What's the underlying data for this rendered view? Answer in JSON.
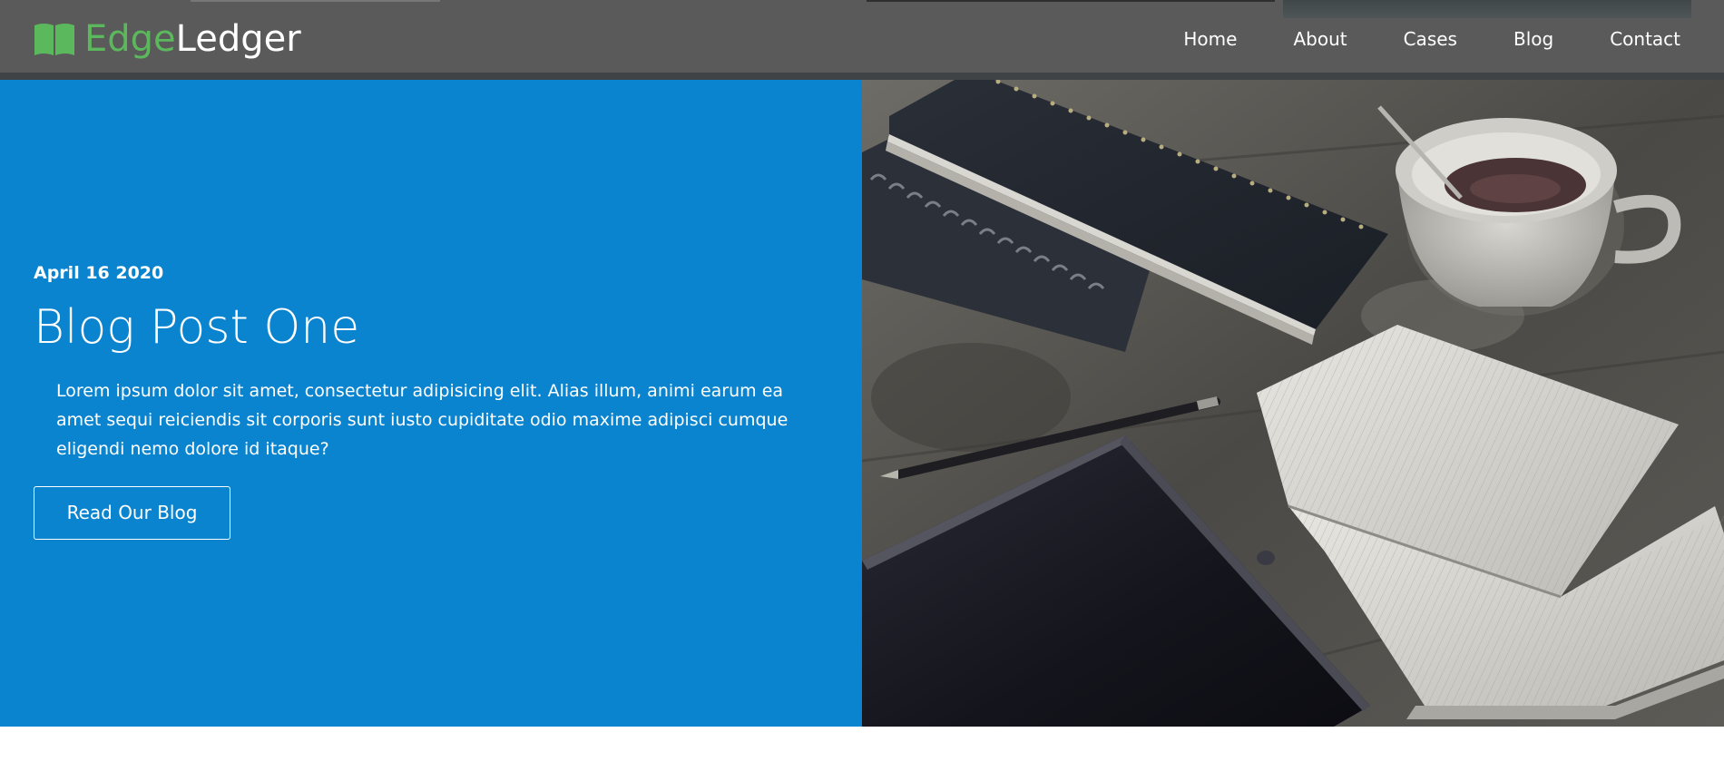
{
  "brand": {
    "name_part1": "Edge",
    "name_part2": "Ledger",
    "icon": "open-book-icon",
    "accent_color": "#5cb85c"
  },
  "nav": {
    "items": [
      {
        "label": "Home"
      },
      {
        "label": "About"
      },
      {
        "label": "Cases"
      },
      {
        "label": "Blog"
      },
      {
        "label": "Contact"
      }
    ]
  },
  "hero": {
    "date": "April 16 2020",
    "title": "Blog Post One",
    "body": "Lorem ipsum dolor sit amet, consectetur adipisicing elit. Alias illum, animi earum ea amet sequi reiciendis sit corporis sunt iusto cupiditate odio maxime adipisci cumque eligendi nemo dolore id itaque?",
    "button_label": "Read Our Blog",
    "background_color": "#0a84cf",
    "image_subject": "desk-with-notebooks-coffee-tablet-image"
  }
}
